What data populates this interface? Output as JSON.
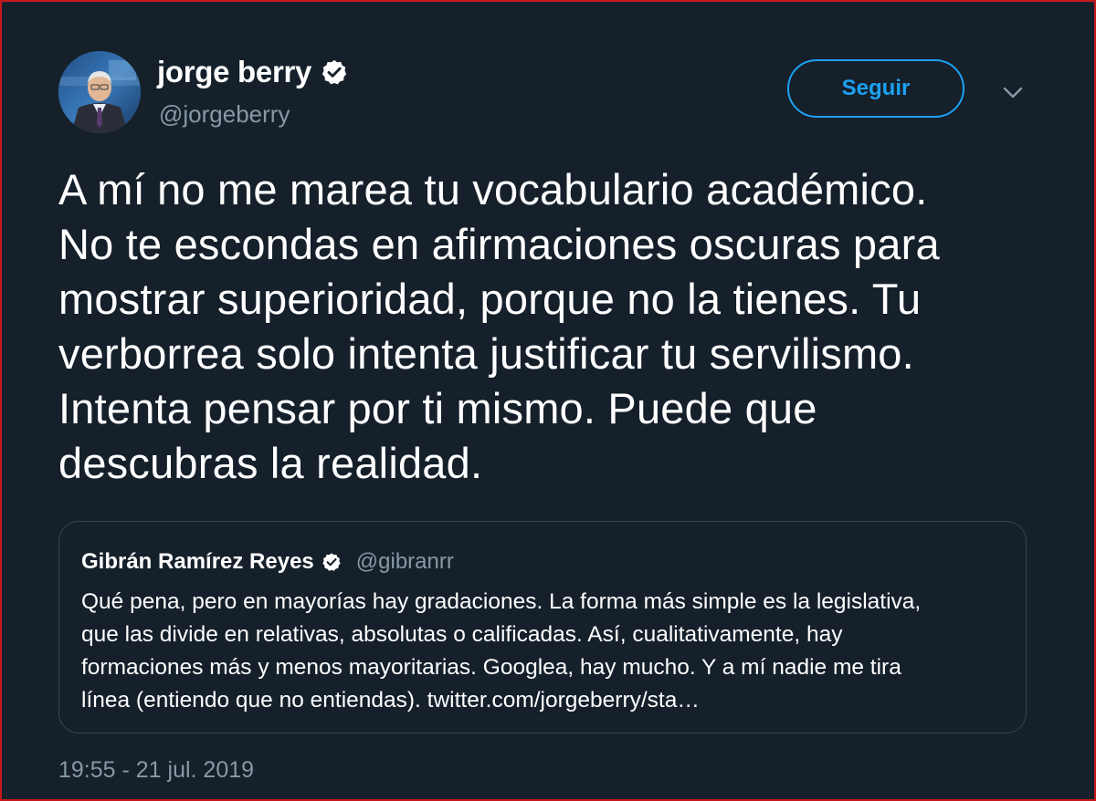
{
  "author": {
    "display_name": "jorge berry",
    "handle": "@jorgeberry",
    "verified_icon": "verified-badge"
  },
  "follow_button": {
    "label": "Seguir"
  },
  "menu_icon": "chevron-down",
  "tweet": {
    "text": "A mí no me marea tu vocabulario académico.\nNo te escondas en afirmaciones oscuras para\nmostrar superioridad, porque no la tienes. Tu\nverborrea solo intenta justificar tu servilismo.\nIntenta pensar por ti mismo. Puede que\ndescubras la realidad.",
    "timestamp": "19:55 - 21 jul. 2019"
  },
  "quoted_tweet": {
    "display_name": "Gibrán Ramírez Reyes",
    "handle": "@gibranrr",
    "text": "Qué pena, pero en mayorías hay gradaciones. La forma más simple es la legislativa,\nque las divide en relativas, absolutas o calificadas. Así, cualitativamente, hay\nformaciones más y menos mayoritarias. Googlea, hay mucho. Y a mí nadie me tira\nlínea (entiendo que no entiendas). twitter.com/jorgeberry/sta…"
  },
  "colors": {
    "background": "#15202b",
    "accent": "#1da1f2",
    "muted_text": "#8899a6",
    "border": "#38444d",
    "frame": "#c8181b"
  }
}
